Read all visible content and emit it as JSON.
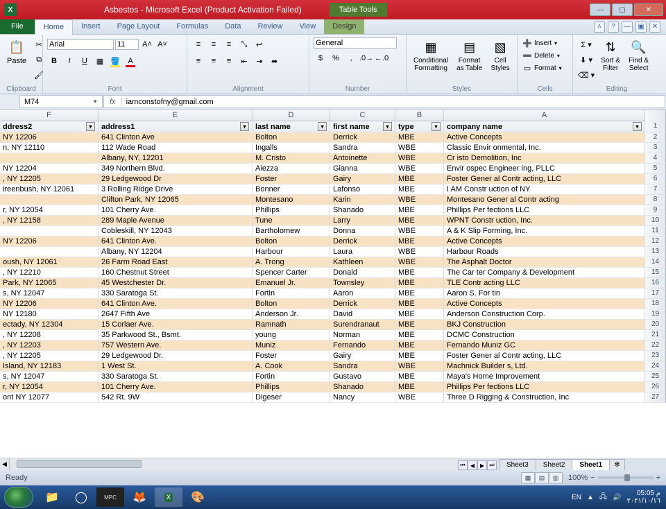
{
  "titlebar": {
    "title": "Asbestos - Microsoft Excel (Product Activation Failed)",
    "table_tools": "Table Tools",
    "design": "Design"
  },
  "tabs": {
    "file": "File",
    "home": "Home",
    "insert": "Insert",
    "page_layout": "Page Layout",
    "formulas": "Formulas",
    "data": "Data",
    "review": "Review",
    "view": "View"
  },
  "ribbon": {
    "clipboard": {
      "title": "Clipboard",
      "paste": "Paste"
    },
    "font": {
      "title": "Font",
      "family": "Arial",
      "size": "11"
    },
    "alignment": {
      "title": "Alignment"
    },
    "number": {
      "title": "Number",
      "format": "General"
    },
    "styles": {
      "title": "Styles",
      "cond": "Conditional\nFormatting",
      "fat": "Format\nas Table",
      "cstyles": "Cell\nStyles"
    },
    "cells": {
      "title": "Cells",
      "insert": "Insert",
      "delete": "Delete",
      "format": "Format"
    },
    "editing": {
      "title": "Editing",
      "sort": "Sort &\nFilter",
      "find": "Find &\nSelect"
    }
  },
  "namebox": "M74",
  "formula": "iamconstofny@gmail.com",
  "columns": {
    "F": "F",
    "E": "E",
    "D": "D",
    "C": "C",
    "B": "B",
    "A": "A"
  },
  "headers": {
    "addr2": "ddress2",
    "addr1": "address1",
    "last": "last name",
    "first": "first name",
    "type": "type",
    "company": "company name"
  },
  "rows": [
    {
      "n": "2",
      "a2": "NY 12206",
      "a1": "641 Clinton Ave",
      "ln": "Bolton",
      "fn": "Derrick",
      "ty": "MBE",
      "co": "Active Concepts"
    },
    {
      "n": "3",
      "a2": "n, NY 12110",
      "a1": "112 Wade Road",
      "ln": "Ingalls",
      "fn": "Sandra",
      "ty": "WBE",
      "co": "Classic Envir onmental, Inc."
    },
    {
      "n": "4",
      "a2": "",
      "a1": "Albany, NY, 12201",
      "ln": "M. Cristo",
      "fn": "Antoinette",
      "ty": "WBE",
      "co": "Cr isto Demolition, Inc"
    },
    {
      "n": "5",
      "a2": "NY 12204",
      "a1": "349 Northern Blvd.",
      "ln": "Aiezza",
      "fn": "Gianna",
      "ty": "WBE",
      "co": "Envir ospec Engineer ing, PLLC"
    },
    {
      "n": "6",
      "a2": ", NY 12205",
      "a1": "29 Ledgewood Dr",
      "ln": "Foster",
      "fn": "Gairy",
      "ty": "MBE",
      "co": "Foster Gener al Contr acting, LLC"
    },
    {
      "n": "7",
      "a2": "ireenbush, NY 12061",
      "a1": "3 Rolling Ridge Drive",
      "ln": "Bonner",
      "fn": "Lafonso",
      "ty": "MBE",
      "co": "I AM Constr uction of NY"
    },
    {
      "n": "8",
      "a2": "",
      "a1": "Clifton Park, NY 12065",
      "ln": "Montesano",
      "fn": "Karin",
      "ty": "WBE",
      "co": "Montesano Gener al Contr acting"
    },
    {
      "n": "9",
      "a2": "r, NY 12054",
      "a1": "101 Cherry Ave.",
      "ln": "Phillips",
      "fn": "Shanado",
      "ty": "MBE",
      "co": "Phillips Per fections LLC"
    },
    {
      "n": "10",
      "a2": ", NY 12158",
      "a1": "289 Maple Avenue",
      "ln": "Tune",
      "fn": "Larry",
      "ty": "MBE",
      "co": "WPNT Constr uction, Inc."
    },
    {
      "n": "11",
      "a2": "",
      "a1": "Cobleskill, NY 12043",
      "ln": "Bartholomew",
      "fn": "Donna",
      "ty": "WBE",
      "co": "A & K Slip Forming, Inc."
    },
    {
      "n": "12",
      "a2": "NY 12206",
      "a1": "641 Clinton Ave.",
      "ln": "Bolton",
      "fn": "Derrick",
      "ty": "MBE",
      "co": "Active Concepts"
    },
    {
      "n": "13",
      "a2": "",
      "a1": "Albany, NY 12204",
      "ln": "Harbour",
      "fn": "Laura",
      "ty": "WBE",
      "co": "Harbour Roads"
    },
    {
      "n": "14",
      "a2": "oush, NY 12061",
      "a1": "26 Farm Road East",
      "ln": "A. Trong",
      "fn": "Kathleen",
      "ty": "WBE",
      "co": "The Asphalt Doctor"
    },
    {
      "n": "15",
      "a2": ", NY 12210",
      "a1": "160 Chestnut Street",
      "ln": "Spencer Carter",
      "fn": "Donald",
      "ty": "MBE",
      "co": "The Car ter Company & Development"
    },
    {
      "n": "16",
      "a2": "Park, NY 12065",
      "a1": "45 Westchester Dr.",
      "ln": "Emanuel Jr.",
      "fn": "Townsley",
      "ty": "MBE",
      "co": "TLE Contr acting LLC"
    },
    {
      "n": "17",
      "a2": "s, NY 12047",
      "a1": "330 Saratoga St.",
      "ln": "Fortin",
      "fn": "Aaron",
      "ty": "MBE",
      "co": "Aaron S. For tin"
    },
    {
      "n": "18",
      "a2": "NY 12206",
      "a1": "641 Clinton Ave.",
      "ln": "Bolton",
      "fn": "Derrick",
      "ty": "MBE",
      "co": "Active Concepts"
    },
    {
      "n": "19",
      "a2": "NY 12180",
      "a1": "2647 Fifth Ave",
      "ln": "Anderson Jr.",
      "fn": "David",
      "ty": "MBE",
      "co": "Anderson Construction Corp."
    },
    {
      "n": "20",
      "a2": "ectady, NY 12304",
      "a1": "15 Corlaer Ave.",
      "ln": "Ramnath",
      "fn": "Surendranaut",
      "ty": "MBE",
      "co": "BKJ Construction"
    },
    {
      "n": "21",
      "a2": ", NY 12208",
      "a1": "35 Parkwood St., Bsmt.",
      "ln": "young",
      "fn": "Norman",
      "ty": "MBE",
      "co": "DCMC Construction"
    },
    {
      "n": "22",
      "a2": ", NY 12203",
      "a1": "757 Western Ave.",
      "ln": "Muniz",
      "fn": "Fernando",
      "ty": "MBE",
      "co": "Fernando Muniz GC"
    },
    {
      "n": "23",
      "a2": ", NY 12205",
      "a1": "29 Ledgewood Dr.",
      "ln": "Foster",
      "fn": "Gairy",
      "ty": "MBE",
      "co": "Foster Gener al Contr acting, LLC"
    },
    {
      "n": "24",
      "a2": "Island, NY 12183",
      "a1": "1 West St.",
      "ln": "A. Cook",
      "fn": "Sandra",
      "ty": "WBE",
      "co": "Machnick Builder s, Ltd."
    },
    {
      "n": "25",
      "a2": "s, NY 12047",
      "a1": "330 Saratoga St.",
      "ln": "Fortin",
      "fn": "Gustavo",
      "ty": "MBE",
      "co": "Maya's Home Improvement"
    },
    {
      "n": "26",
      "a2": "r, NY 12054",
      "a1": "101 Cherry Ave.",
      "ln": "Phillips",
      "fn": "Shanado",
      "ty": "MBE",
      "co": "Phillips Per fections LLC"
    },
    {
      "n": "27",
      "a2": "ont NY 12077",
      "a1": "542 Rt. 9W",
      "ln": "Digeser",
      "fn": "Nancy",
      "ty": "WBE",
      "co": "Three D Rigging & Construction, Inc"
    }
  ],
  "sheets": {
    "s1": "Sheet1",
    "s2": "Sheet2",
    "s3": "Sheet3"
  },
  "status": {
    "ready": "Ready",
    "zoom": "100%"
  },
  "tray": {
    "lang": "EN",
    "time": "05:05 م",
    "date": "٢٠٢١/١٠/١٦"
  }
}
